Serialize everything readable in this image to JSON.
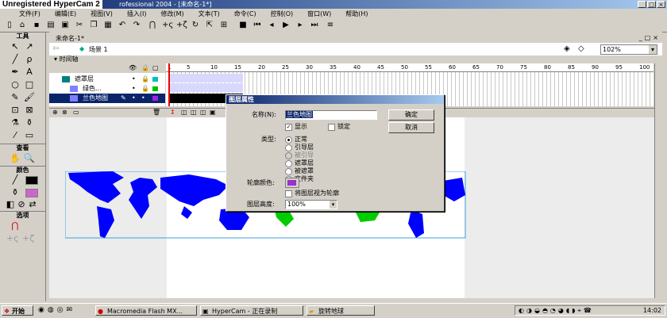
{
  "watermark": "Unregistered HyperCam 2",
  "window": {
    "title": "rofessional 2004 - [未命名-1*]"
  },
  "menu": [
    "文件(F)",
    "编辑(E)",
    "视图(V)",
    "插入(I)",
    "修改(M)",
    "文本(T)",
    "命令(C)",
    "控制(O)",
    "窗口(W)",
    "帮助(H)"
  ],
  "tools": {
    "header": "工具",
    "view_header": "查看",
    "colors_header": "颜色",
    "options_header": "选项"
  },
  "document": {
    "tab": "未命名-1*",
    "scene": "场景 1",
    "zoom": "102%"
  },
  "timeline": {
    "header": "时间轴",
    "ruler": [
      "1",
      "5",
      "10",
      "15",
      "20",
      "25",
      "30",
      "35",
      "40",
      "45",
      "50",
      "55",
      "60",
      "65",
      "70",
      "75",
      "80",
      "85",
      "90",
      "95",
      "100"
    ],
    "layers": [
      {
        "name": "遮罩层",
        "color": "#00c0c0"
      },
      {
        "name": "绿色...",
        "color": "#00c000"
      },
      {
        "name": "兰色地图",
        "color": "#a020f0",
        "selected": true
      }
    ]
  },
  "dialog": {
    "title": "图层属性",
    "name_label": "名称(N):",
    "name_value": "兰色地图",
    "ok": "确定",
    "cancel": "取消",
    "show_label": "显示",
    "lock_label": "锁定",
    "type_label": "类型:",
    "types": [
      "正常",
      "引导层",
      "被引导",
      "遮罩层",
      "被遮罩",
      "文件夹"
    ],
    "outline_color_label": "轮廓颜色:",
    "outline_color": "#9933cc",
    "outline_view_label": "将图层视为轮廓",
    "height_label": "图层高度:",
    "height_value": "100%"
  },
  "taskbar": {
    "start": "开始",
    "tasks": [
      "Macromedia Flash MX...",
      "HyperCam - 正在录制",
      "旋转地球"
    ],
    "clock": "14:02"
  },
  "colors": {
    "map_blue": "#0000ff",
    "map_green": "#00cc00",
    "title_blue": "#0a246a"
  }
}
